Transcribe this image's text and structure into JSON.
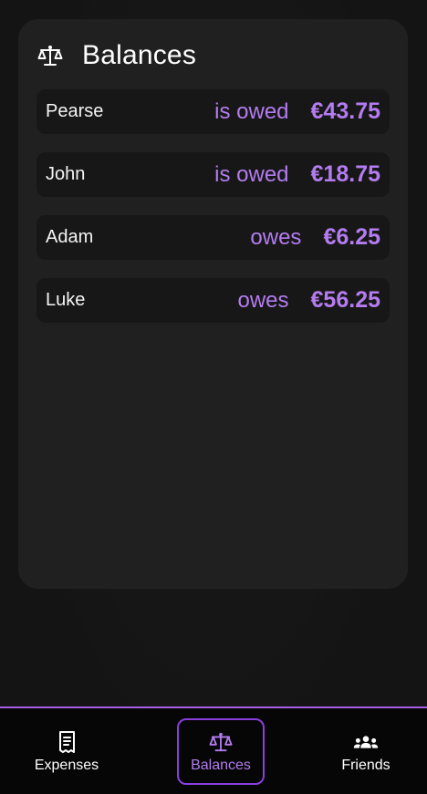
{
  "card": {
    "title": "Balances",
    "icon": "scale-icon"
  },
  "balances": [
    {
      "name": "Pearse",
      "status": "is owed",
      "amount": "€43.75"
    },
    {
      "name": "John",
      "status": "is owed",
      "amount": "€18.75"
    },
    {
      "name": "Adam",
      "status": "owes",
      "amount": "€6.25"
    },
    {
      "name": "Luke",
      "status": "owes",
      "amount": "€56.25"
    }
  ],
  "nav": {
    "expenses": {
      "label": "Expenses",
      "icon": "receipt-icon"
    },
    "balances": {
      "label": "Balances",
      "icon": "scale-icon",
      "active": true
    },
    "friends": {
      "label": "Friends",
      "icon": "group-icon"
    }
  },
  "colors": {
    "accent": "#b47cf0",
    "accent_border": "#8a3fdc",
    "card_bg": "#202020",
    "row_bg": "#171717",
    "nav_bg": "#060606"
  }
}
